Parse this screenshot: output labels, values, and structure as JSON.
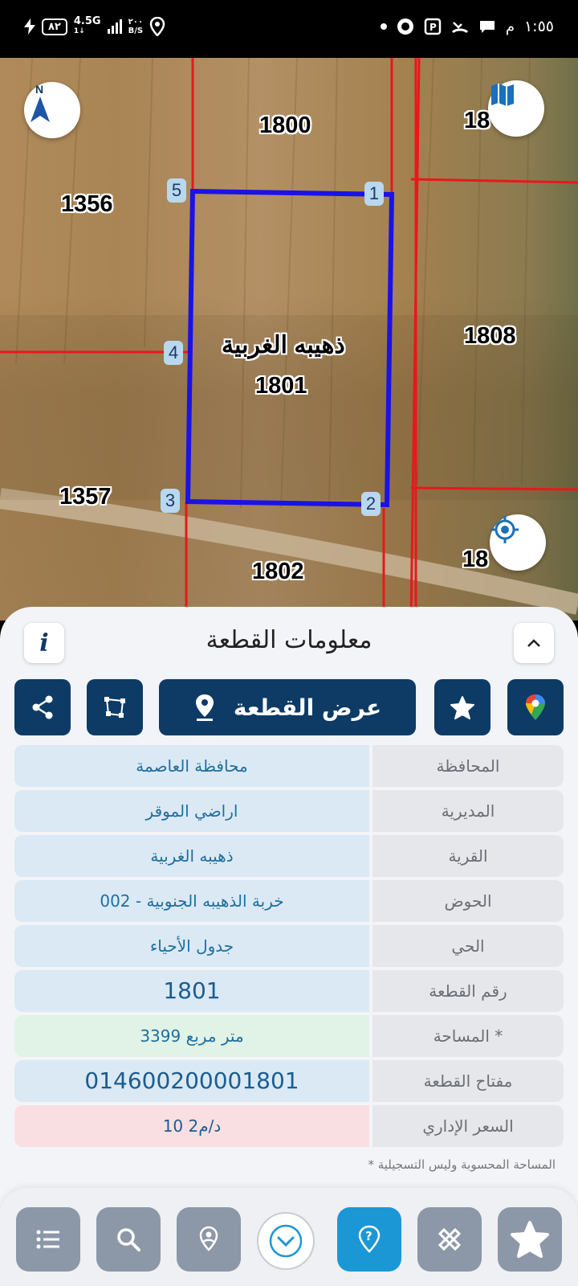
{
  "status": {
    "time": "١:٥٥",
    "am_pm": "م",
    "battery": "٨٢",
    "network": "4.5G",
    "network_sub": "1↓",
    "speed_value": "٢٠٠",
    "speed_unit": "B/S"
  },
  "map": {
    "parcels": [
      {
        "label": "1800"
      },
      {
        "label": "1356"
      },
      {
        "label": "1808"
      },
      {
        "label": "1357"
      },
      {
        "label": "1802"
      },
      {
        "label": "18"
      },
      {
        "label": "18"
      }
    ],
    "selected_parcel": {
      "name": "ذهيبه الغربية",
      "number": "1801"
    },
    "vertices": [
      "1",
      "2",
      "3",
      "4",
      "5"
    ],
    "compass_letter": "N",
    "colors": {
      "boundary": "#e8181b",
      "selection": "#1a12e6"
    }
  },
  "sheet": {
    "title": "معلومات القطعة",
    "show_parcel_label": "عرض القطعة",
    "rows": [
      {
        "label": "المحافظة",
        "value": "محافظة العاصمة"
      },
      {
        "label": "المديرية",
        "value": "اراضي الموقر"
      },
      {
        "label": "القرية",
        "value": "ذهيبه الغربية"
      },
      {
        "label": "الحوض",
        "value": "خربة الذهيبه الجنوبية - 002"
      },
      {
        "label": "الحي",
        "value": "جدول الأحياء"
      },
      {
        "label": "رقم القطعة",
        "value": "1801"
      },
      {
        "label": "المساحة *",
        "value": "3399  متر مربع"
      },
      {
        "label": "مفتاح القطعة",
        "value": "014600200001801"
      },
      {
        "label": "السعر الإداري",
        "value": "10 د/م2"
      }
    ],
    "footnote": "* المساحة المحسوبة وليس التسجيلية"
  },
  "nav": {
    "items": [
      "list",
      "search",
      "location-pin",
      "expand",
      "help",
      "measure",
      "favorite"
    ]
  }
}
